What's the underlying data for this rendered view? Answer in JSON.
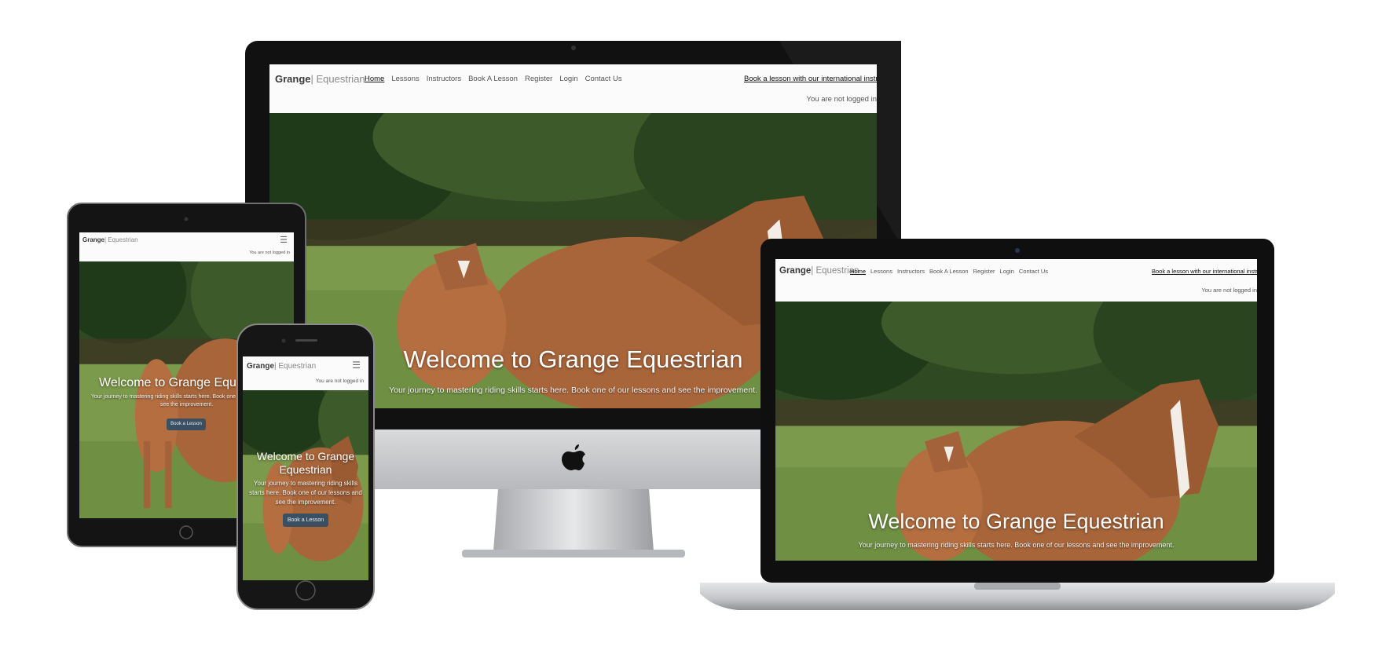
{
  "site": {
    "brand_bold": "Grange",
    "brand_light": "| Equestrian",
    "nav": [
      "Home",
      "Lessons",
      "Instructors",
      "Book A Lesson",
      "Register",
      "Login",
      "Contact Us"
    ],
    "promo_link": "Book a lesson with our international instructors",
    "login_status": "You are not logged in",
    "hero_title": "Welcome to Grange Equestrian",
    "hero_subtitle": "Your journey to mastering riding skills starts here. Book one of our lessons and see the improvement.",
    "hero_button": "Book a Lesson",
    "menu_icon_glyph": "☰"
  },
  "colors": {
    "navbar": "#fbfbfb",
    "button": "#3b4f63",
    "device_black": "#111111",
    "stand_silver": "#c9cacc"
  },
  "icons": [
    "apple-logo-icon",
    "hamburger-menu-icon",
    "camera-icon",
    "home-button-icon"
  ]
}
